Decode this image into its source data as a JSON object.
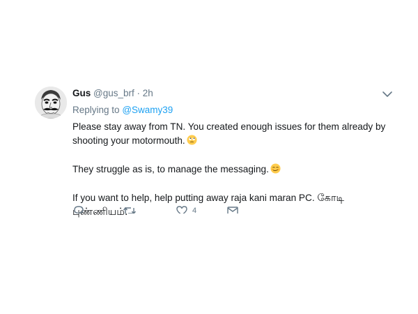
{
  "tweet": {
    "author_name": "Gus",
    "handle": "@gus_brf",
    "separator": "·",
    "time": "2h",
    "replying_prefix": "Replying to",
    "replying_to": "@Swamy39",
    "body": {
      "line1": "Please stay away from TN. You created enough issues for them already by shooting your motormouth.",
      "line2": "They struggle as is, to manage the messaging.",
      "line3_en": "If you want to help, help putting away raja kani maran PC.",
      "line3_ta": "கோடி புண்ணியம்."
    },
    "actions": {
      "reply_icon": "reply-icon",
      "retweet_icon": "retweet-icon",
      "like_icon": "heart-icon",
      "like_count": "4",
      "dm_icon": "envelope-icon"
    },
    "colors": {
      "text": "#14171a",
      "secondary": "#657786",
      "link": "#1da1f2"
    }
  }
}
